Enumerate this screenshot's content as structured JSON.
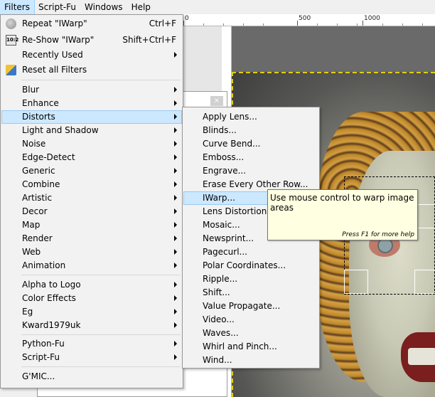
{
  "menubar": {
    "items": [
      {
        "label": "Filters"
      },
      {
        "label": "Script-Fu"
      },
      {
        "label": "Windows"
      },
      {
        "label": "Help"
      }
    ]
  },
  "ruler": {
    "labels": [
      "0",
      "500",
      "1000"
    ]
  },
  "filters_menu": {
    "items": [
      {
        "label": "Repeat \"IWarp\"",
        "accel": "Ctrl+F",
        "icon": "repeat-icon"
      },
      {
        "label": "Re-Show \"IWarp\"",
        "accel": "Shift+Ctrl+F",
        "icon": "reshow-icon",
        "icon_text": "10:2"
      },
      {
        "label": "Recently Used",
        "submenu": true
      },
      {
        "label": "Reset all Filters",
        "icon": "reset-filters-icon"
      },
      {
        "label": "Blur",
        "submenu": true
      },
      {
        "label": "Enhance",
        "submenu": true
      },
      {
        "label": "Distorts",
        "submenu": true,
        "highlighted": true
      },
      {
        "label": "Light and Shadow",
        "submenu": true
      },
      {
        "label": "Noise",
        "submenu": true
      },
      {
        "label": "Edge-Detect",
        "submenu": true
      },
      {
        "label": "Generic",
        "submenu": true
      },
      {
        "label": "Combine",
        "submenu": true
      },
      {
        "label": "Artistic",
        "submenu": true
      },
      {
        "label": "Decor",
        "submenu": true
      },
      {
        "label": "Map",
        "submenu": true
      },
      {
        "label": "Render",
        "submenu": true
      },
      {
        "label": "Web",
        "submenu": true
      },
      {
        "label": "Animation",
        "submenu": true
      },
      {
        "label": "Alpha to Logo",
        "submenu": true
      },
      {
        "label": "Color Effects",
        "submenu": true
      },
      {
        "label": "Eg",
        "submenu": true
      },
      {
        "label": "Kward1979uk",
        "submenu": true
      },
      {
        "label": "Python-Fu",
        "submenu": true
      },
      {
        "label": "Script-Fu",
        "submenu": true
      },
      {
        "label": "G'MIC..."
      }
    ]
  },
  "distorts_menu": {
    "items": [
      {
        "label": "Apply Lens..."
      },
      {
        "label": "Blinds..."
      },
      {
        "label": "Curve Bend..."
      },
      {
        "label": "Emboss..."
      },
      {
        "label": "Engrave..."
      },
      {
        "label": "Erase Every Other Row..."
      },
      {
        "label": "IWarp...",
        "highlighted": true
      },
      {
        "label": "Lens Distortion..."
      },
      {
        "label": "Mosaic..."
      },
      {
        "label": "Newsprint..."
      },
      {
        "label": "Pagecurl..."
      },
      {
        "label": "Polar Coordinates..."
      },
      {
        "label": "Ripple..."
      },
      {
        "label": "Shift..."
      },
      {
        "label": "Value Propagate..."
      },
      {
        "label": "Video..."
      },
      {
        "label": "Waves..."
      },
      {
        "label": "Whirl and Pinch..."
      },
      {
        "label": "Wind..."
      }
    ]
  },
  "tooltip": {
    "text": "Use mouse control to warp image areas",
    "help": "Press F1 for more help"
  },
  "dialog": {
    "close_label": "×"
  },
  "colors": {
    "highlight": "#cce8ff",
    "highlight_border": "#99c9ef",
    "tooltip_bg": "#ffffe1",
    "layer_boundary": "#e1d000"
  }
}
